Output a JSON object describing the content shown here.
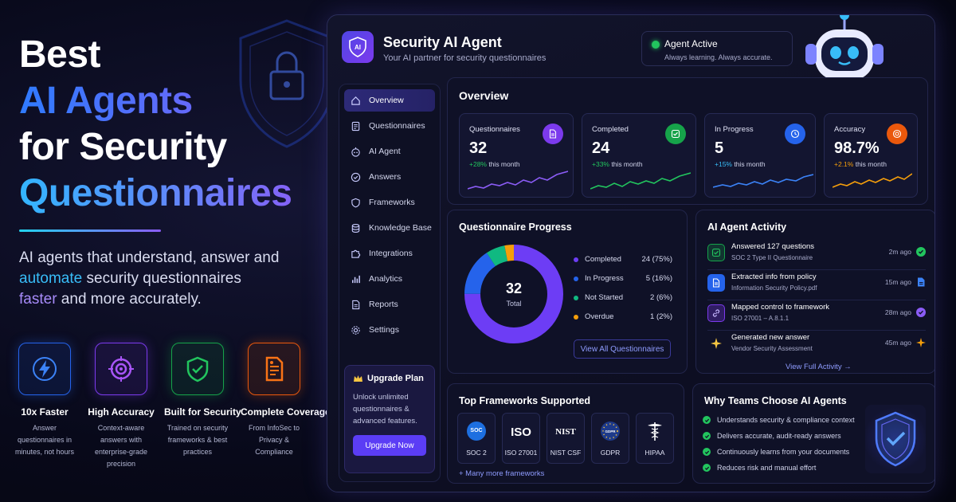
{
  "hero": {
    "line1": "Best",
    "line2": "AI Agents",
    "line3": "for Security",
    "line4": "Questionnaires",
    "sub_part1": "AI agents that understand, answer and ",
    "sub_hl1": "automate",
    "sub_part2": " security questionnaires ",
    "sub_hl2": "faster",
    "sub_part3": " and more accurately."
  },
  "features": [
    {
      "title": "10x Faster",
      "desc": "Answer questionnaires in minutes, not hours",
      "icon": "lightning-icon"
    },
    {
      "title": "High Accuracy",
      "desc": "Context-aware answers with enterprise-grade precision",
      "icon": "target-icon"
    },
    {
      "title": "Built for Security",
      "desc": "Trained on security frameworks & best practices",
      "icon": "shield-check-icon"
    },
    {
      "title": "Complete Coverage",
      "desc": "From InfoSec to Privacy & Compliance",
      "icon": "document-icon"
    }
  ],
  "app": {
    "logo_text": "AI",
    "title": "Security AI Agent",
    "subtitle": "Your AI partner for security questionnaires",
    "status_title": "Agent Active",
    "status_sub": "Always learning. Always accurate."
  },
  "sidebar": {
    "items": [
      {
        "label": "Overview",
        "icon": "home-icon",
        "active": true
      },
      {
        "label": "Questionnaires",
        "icon": "document-icon"
      },
      {
        "label": "AI Agent",
        "icon": "bot-icon"
      },
      {
        "label": "Answers",
        "icon": "check-circle-icon"
      },
      {
        "label": "Frameworks",
        "icon": "shield-icon"
      },
      {
        "label": "Knowledge Base",
        "icon": "database-icon"
      },
      {
        "label": "Integrations",
        "icon": "puzzle-icon"
      },
      {
        "label": "Analytics",
        "icon": "bar-chart-icon"
      },
      {
        "label": "Reports",
        "icon": "report-icon"
      },
      {
        "label": "Settings",
        "icon": "gear-icon"
      }
    ],
    "upgrade_title": "Upgrade Plan",
    "upgrade_desc": "Unlock unlimited questionnaires & advanced features.",
    "upgrade_button": "Upgrade Now"
  },
  "overview": {
    "title": "Overview",
    "stats": [
      {
        "label": "Questionnaires",
        "value": "32",
        "delta": "+28%",
        "delta_suffix": " this month",
        "color": "#7c3aed",
        "delta_color": "#22c55e"
      },
      {
        "label": "Completed",
        "value": "24",
        "delta": "+33%",
        "delta_suffix": " this month",
        "color": "#16a34a",
        "delta_color": "#22c55e"
      },
      {
        "label": "In Progress",
        "value": "5",
        "delta": "+15%",
        "delta_suffix": " this month",
        "color": "#2563eb",
        "delta_color": "#38bdf8"
      },
      {
        "label": "Accuracy",
        "value": "98.7%",
        "delta": "+2.1%",
        "delta_suffix": " this month",
        "color": "#ea580c",
        "delta_color": "#f59e0b"
      }
    ]
  },
  "progress": {
    "title": "Questionnaire Progress",
    "total": "32",
    "total_label": "Total",
    "view_button": "View All Questionnaires"
  },
  "chart_data": {
    "type": "pie",
    "title": "Questionnaire Progress",
    "categories": [
      "Completed",
      "In Progress",
      "Not Started",
      "Overdue"
    ],
    "values": [
      24,
      5,
      2,
      1
    ],
    "labels": [
      "24 (75%)",
      "5 (16%)",
      "2 (6%)",
      "1 (2%)"
    ],
    "colors": [
      "#6d3df5",
      "#2563eb",
      "#10b981",
      "#f59e0b"
    ]
  },
  "activity": {
    "title": "AI Agent Activity",
    "items": [
      {
        "title": "Answered 127 questions",
        "sub": "SOC 2 Type II Questionnaire",
        "time": "2m ago",
        "color": "#16a34a",
        "icon": "check-square-icon"
      },
      {
        "title": "Extracted info from policy",
        "sub": "Information Security Policy.pdf",
        "time": "15m ago",
        "color": "#2563eb",
        "icon": "file-icon"
      },
      {
        "title": "Mapped control to framework",
        "sub": "ISO 27001 – A.8.1.1",
        "time": "28m ago",
        "color": "#7c3aed",
        "icon": "link-icon"
      },
      {
        "title": "Generated new answer",
        "sub": "Vendor Security Assessment",
        "time": "45m ago",
        "color": "#f59e0b",
        "icon": "sparkle-icon"
      }
    ],
    "view_full": "View Full Activity →"
  },
  "frameworks": {
    "title": "Top Frameworks Supported",
    "items": [
      {
        "name": "SOC 2",
        "logo": "SOC"
      },
      {
        "name": "ISO 27001",
        "logo": "ISO"
      },
      {
        "name": "NIST CSF",
        "logo": "NIST"
      },
      {
        "name": "GDPR",
        "logo": "GDPR"
      },
      {
        "name": "HIPAA",
        "logo": ""
      }
    ],
    "more": "+ Many more frameworks"
  },
  "why": {
    "title": "Why Teams Choose AI Agents",
    "items": [
      "Understands security & compliance context",
      "Delivers accurate, audit-ready answers",
      "Continuously learns from your documents",
      "Reduces risk and manual effort"
    ]
  }
}
